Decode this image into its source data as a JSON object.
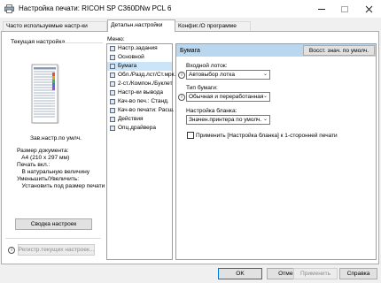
{
  "window": {
    "title": "Настройка печати: RICOH SP C360DNw PCL 6",
    "controls": [
      "minimize-icon",
      "maximize-icon",
      "close-icon"
    ]
  },
  "tabs": [
    {
      "label": "Часто используемые настр-ки",
      "active": false
    },
    {
      "label": "Детальн.настройки",
      "active": true
    },
    {
      "label": "Конфиг./О программе",
      "active": false
    }
  ],
  "left_panel": {
    "group_label": "Текущая настройка",
    "preview_caption": "Зав.настр.по умлч.",
    "info_lines": [
      "Размер документа:",
      "   A4 (210 x 297 мм)",
      "Печать вкл.:",
      "   В натуральную величину",
      "Уменьшить/Увеличить:",
      "   Установить под размер печати"
    ],
    "summary_button": "Сводка настроек",
    "register_button": "Регистр.текущих настроек..."
  },
  "menu": {
    "label": "Меню:",
    "items": [
      {
        "label": "Настр.задания",
        "selected": false
      },
      {
        "label": "Основной",
        "selected": false
      },
      {
        "label": "Бумага",
        "selected": true
      },
      {
        "label": "Обл./Разд.лст/Ст.мрк.",
        "selected": false
      },
      {
        "label": "2-ст./Компон./Буклет",
        "selected": false
      },
      {
        "label": "Настр-ки вывода",
        "selected": false
      },
      {
        "label": "Кач-во печ.: Станд.",
        "selected": false
      },
      {
        "label": "Кач-во печати: Расш.",
        "selected": false
      },
      {
        "label": "Действия",
        "selected": false
      },
      {
        "label": "Опц.драйвера",
        "selected": false
      }
    ]
  },
  "content": {
    "section_title": "Бумага",
    "restore_button": "Восст. знач. по умолч.",
    "input_tray": {
      "label": "Входной лоток:",
      "value": "Автовыбор лотка"
    },
    "paper_type": {
      "label": "Тип бумаги:",
      "value": "Обычная и переработанная"
    },
    "form_setting": {
      "label": "Настройка бланка:",
      "value": "Значен.принтера по умолч."
    },
    "apply_checkbox": {
      "label": "Применить [Настройка бланка] к 1-сторонней печати",
      "checked": false
    }
  },
  "footer": {
    "ok": "OK",
    "cancel": "Отмена",
    "apply": "Применить",
    "help": "Справка"
  }
}
